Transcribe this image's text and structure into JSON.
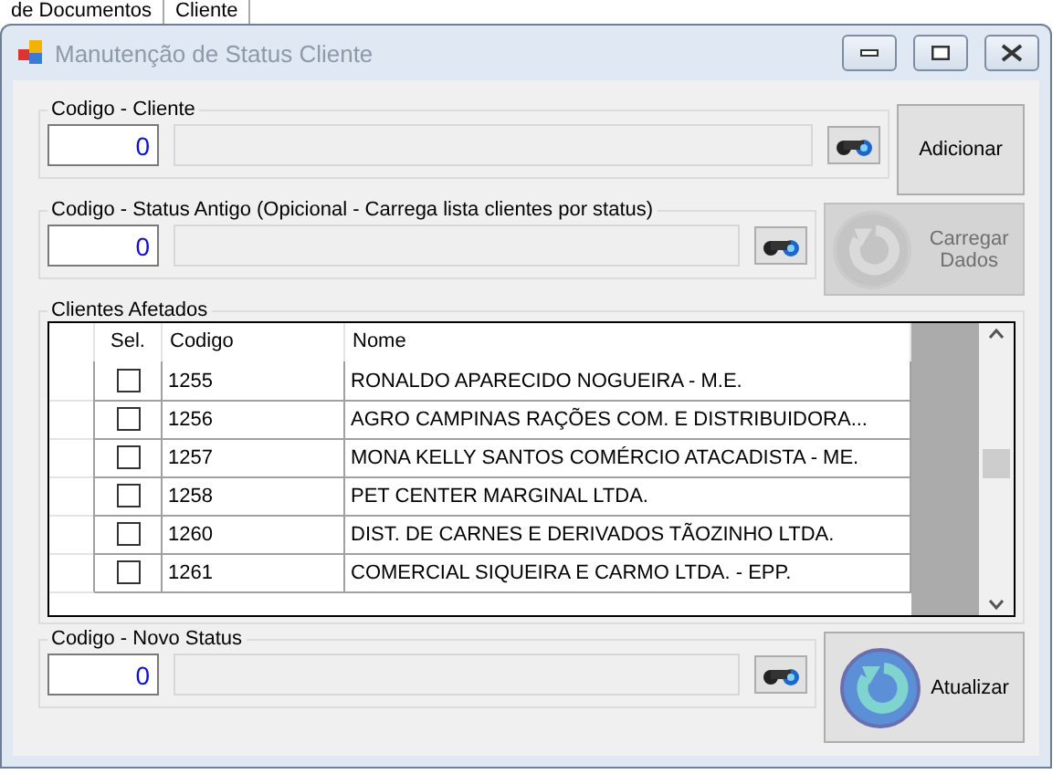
{
  "background": {
    "tabs": [
      "de Documentos",
      "Cliente"
    ]
  },
  "window": {
    "title": "Manutenção de Status Cliente"
  },
  "cliente_group": {
    "label": "Codigo -  Cliente",
    "code": "0",
    "button": "Adicionar"
  },
  "status_antigo_group": {
    "label": "Codigo -  Status Antigo (Opicional - Carrega lista clientes por status)",
    "code": "0",
    "button": {
      "label": "Carregar Dados",
      "disabled": true
    }
  },
  "clientes_afetados": {
    "label": "Clientes Afetados",
    "columns": [
      "Sel.",
      "Codigo",
      "Nome"
    ],
    "rows": [
      {
        "checked": false,
        "codigo": "1255",
        "nome": "RONALDO APARECIDO NOGUEIRA - M.E."
      },
      {
        "checked": false,
        "codigo": "1256",
        "nome": "AGRO CAMPINAS RAÇÕES COM. E DISTRIBUIDORA..."
      },
      {
        "checked": false,
        "codigo": "1257",
        "nome": "MONA KELLY SANTOS COMÉRCIO ATACADISTA - ME."
      },
      {
        "checked": false,
        "codigo": "1258",
        "nome": "PET CENTER MARGINAL LTDA."
      },
      {
        "checked": false,
        "codigo": "1260",
        "nome": "DIST. DE CARNES E DERIVADOS TÃOZINHO LTDA."
      },
      {
        "checked": false,
        "codigo": "1261",
        "nome": "COMERCIAL SIQUEIRA E CARMO LTDA. - EPP."
      }
    ]
  },
  "novo_status_group": {
    "label": "Codigo - Novo Status",
    "code": "0",
    "button": "Atualizar"
  }
}
